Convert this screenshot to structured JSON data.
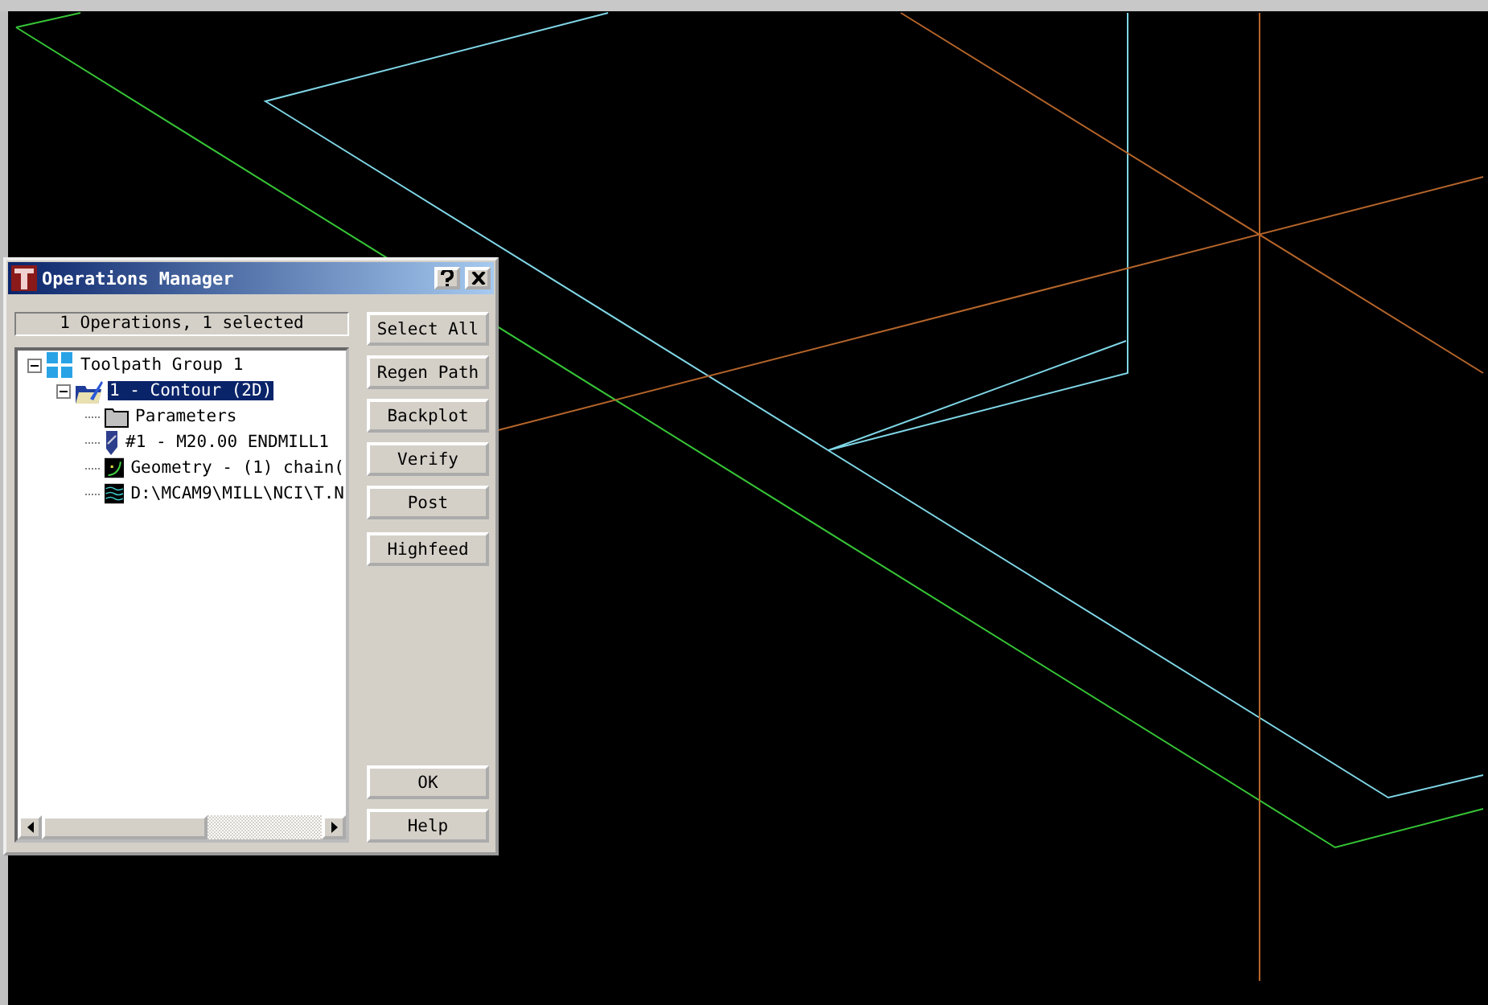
{
  "window": {
    "title": "Operations Manager"
  },
  "status": "1 Operations, 1 selected",
  "tree": [
    {
      "label": "Toolpath Group 1",
      "kind": "group",
      "expanded": true,
      "selected": false,
      "children": [
        {
          "label": "1 - Contour (2D)",
          "kind": "operation",
          "expanded": true,
          "selected": true,
          "children": [
            {
              "label": "Parameters",
              "kind": "parameters",
              "selected": false
            },
            {
              "label": "#1 - M20.00 ENDMILL1",
              "kind": "tool",
              "selected": false
            },
            {
              "label": "Geometry - (1) chain(",
              "kind": "geometry",
              "selected": false
            },
            {
              "label": "D:\\MCAM9\\MILL\\NCI\\T.N",
              "kind": "nci",
              "selected": false
            }
          ]
        }
      ]
    }
  ],
  "buttons": [
    {
      "label": "Select All"
    },
    {
      "label": "Regen Path"
    },
    {
      "label": "Backplot"
    },
    {
      "label": "Verify"
    },
    {
      "label": "Post"
    },
    {
      "label": "Highfeed"
    }
  ],
  "footer_buttons": [
    {
      "label": "OK"
    },
    {
      "label": "Help"
    }
  ]
}
